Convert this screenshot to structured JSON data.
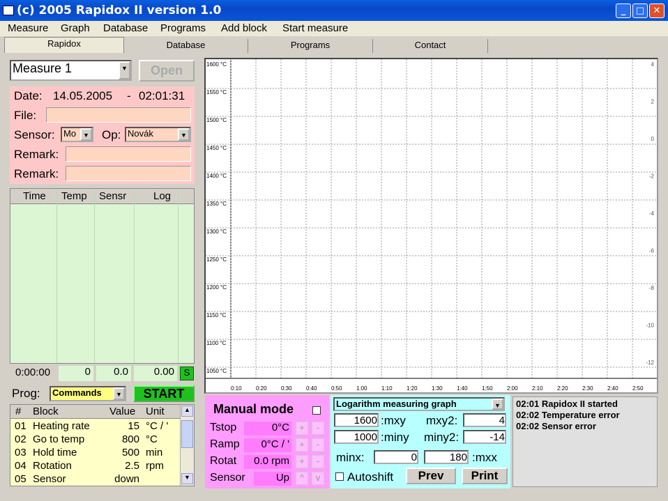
{
  "window": {
    "title": "(c) 2005 Rapidox II version 1.0",
    "min": "_",
    "max": "□",
    "close": "✕"
  },
  "menu": [
    "Measure",
    "Graph",
    "Database",
    "Programs",
    "Add block",
    "Start measure"
  ],
  "tabs": [
    "Rapidox",
    "Database",
    "Programs",
    "Contact"
  ],
  "measure": {
    "selected": "Measure 1",
    "open_label": "Open"
  },
  "info": {
    "date_label": "Date:",
    "date": "14.05.2005",
    "sep": "-",
    "time": "02:01:31",
    "file_label": "File:",
    "sensor_label": "Sensor:",
    "sensor_value": "Mo",
    "op_label": "Op:",
    "op_value": "Novák",
    "remark_label": "Remark:"
  },
  "log_table": {
    "headers": [
      "Time",
      "Temp",
      "Sensr",
      "Log"
    ]
  },
  "status_row": {
    "time": "0:00:00",
    "temp": "0",
    "sensor": "0.0",
    "log": "0.00",
    "flag": "S"
  },
  "prog": {
    "label": "Prog:",
    "selected": "Commands",
    "start_label": "START"
  },
  "blocks": {
    "headers": [
      "#",
      "Block",
      "Value",
      "Unit"
    ],
    "rows": [
      {
        "n": "01",
        "block": "Heating rate",
        "value": "15",
        "unit": "°C / '"
      },
      {
        "n": "02",
        "block": "Go to temp",
        "value": "800",
        "unit": "°C"
      },
      {
        "n": "03",
        "block": "Hold time",
        "value": "500",
        "unit": "min"
      },
      {
        "n": "04",
        "block": "Rotation",
        "value": "2.5",
        "unit": "rpm"
      },
      {
        "n": "05",
        "block": "Sensor",
        "value": "down",
        "unit": ""
      }
    ]
  },
  "manual": {
    "title": "Manual mode",
    "rows": [
      {
        "label": "Tstop",
        "value": "0°C",
        "plus": "+",
        "minus": "-"
      },
      {
        "label": "Ramp",
        "value": "0°C / '",
        "plus": "+",
        "minus": "-"
      },
      {
        "label": "Rotat",
        "value": "0.0 rpm",
        "plus": "+",
        "minus": "-"
      },
      {
        "label": "Sensor",
        "value": "Up",
        "plus": "^",
        "minus": "v"
      }
    ]
  },
  "graphctl": {
    "mode": "Logarithm measuring graph",
    "mxy": "1600",
    "mxy_label": ":mxy",
    "mxy2_label": "mxy2:",
    "mxy2": "4",
    "miny": "1000",
    "miny_label": ":miny",
    "miny2_label": "miny2:",
    "miny2": "-14",
    "minx_label": "minx:",
    "minx": "0",
    "mxx": "180",
    "mxx_label": ":mxx",
    "autoshift": "Autoshift",
    "prev": "Prev",
    "print": "Print"
  },
  "messages": [
    "02:01 Rapidox II started",
    "02:02 Temperature error",
    "02:02 Sensor error"
  ],
  "chart_data": {
    "type": "line",
    "series": [],
    "y_ticks": [
      "1600 °C",
      "1550 °C",
      "1500 °C",
      "1450 °C",
      "1400 °C",
      "1350 °C",
      "1300 °C",
      "1250 °C",
      "1200 °C",
      "1150 °C",
      "1100 °C",
      "1050 °C"
    ],
    "y2_ticks": [
      "4",
      "2",
      "0",
      "-2",
      "-4",
      "-6",
      "-8",
      "-10",
      "-12"
    ],
    "x_ticks": [
      "0:10",
      "0:20",
      "0:30",
      "0:40",
      "0:50",
      "1:00",
      "1:10",
      "1:20",
      "1:30",
      "1:40",
      "1:50",
      "2:00",
      "2:10",
      "2:20",
      "2:30",
      "2:40",
      "2:50"
    ],
    "ylim": [
      1000,
      1600
    ],
    "y2lim": [
      -14,
      4
    ],
    "xlim": [
      0,
      180
    ],
    "grid": true
  },
  "colors": {
    "pink": "#ffc8c8",
    "green": "#dcf6d4",
    "magenta": "#ff9cff",
    "cyan": "#b8ffff",
    "yellow": "#ffff80"
  }
}
